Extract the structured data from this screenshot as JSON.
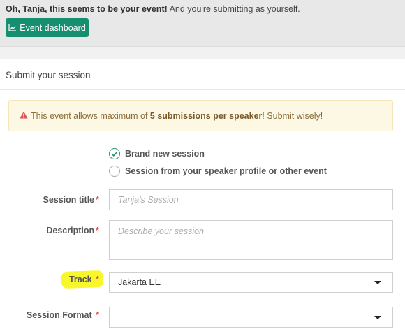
{
  "banner": {
    "greeting_bold": "Oh, Tanja, this seems to be your event!",
    "greeting_rest": " And you're submitting as yourself.",
    "dashboard_button": "Event dashboard",
    "dashboard_icon": "chart-icon",
    "button_color": "#168f70"
  },
  "section": {
    "title": "Submit your session"
  },
  "alert": {
    "icon": "warning-icon",
    "text_before": "This event allows maximum of ",
    "text_bold": "5 submissions per speaker",
    "text_after": "! Submit wisely!"
  },
  "session_type": {
    "options": [
      {
        "label": "Brand new session",
        "checked": true
      },
      {
        "label": "Session from your speaker profile or other event",
        "checked": false
      }
    ]
  },
  "form": {
    "title_label": "Session title",
    "title_placeholder": "Tanja's Session",
    "description_label": "Description",
    "description_placeholder": "Describe your session",
    "track_label": "Track",
    "track_value": "Jakarta EE",
    "format_label": "Session Format",
    "format_value": "",
    "required_mark": "*"
  }
}
